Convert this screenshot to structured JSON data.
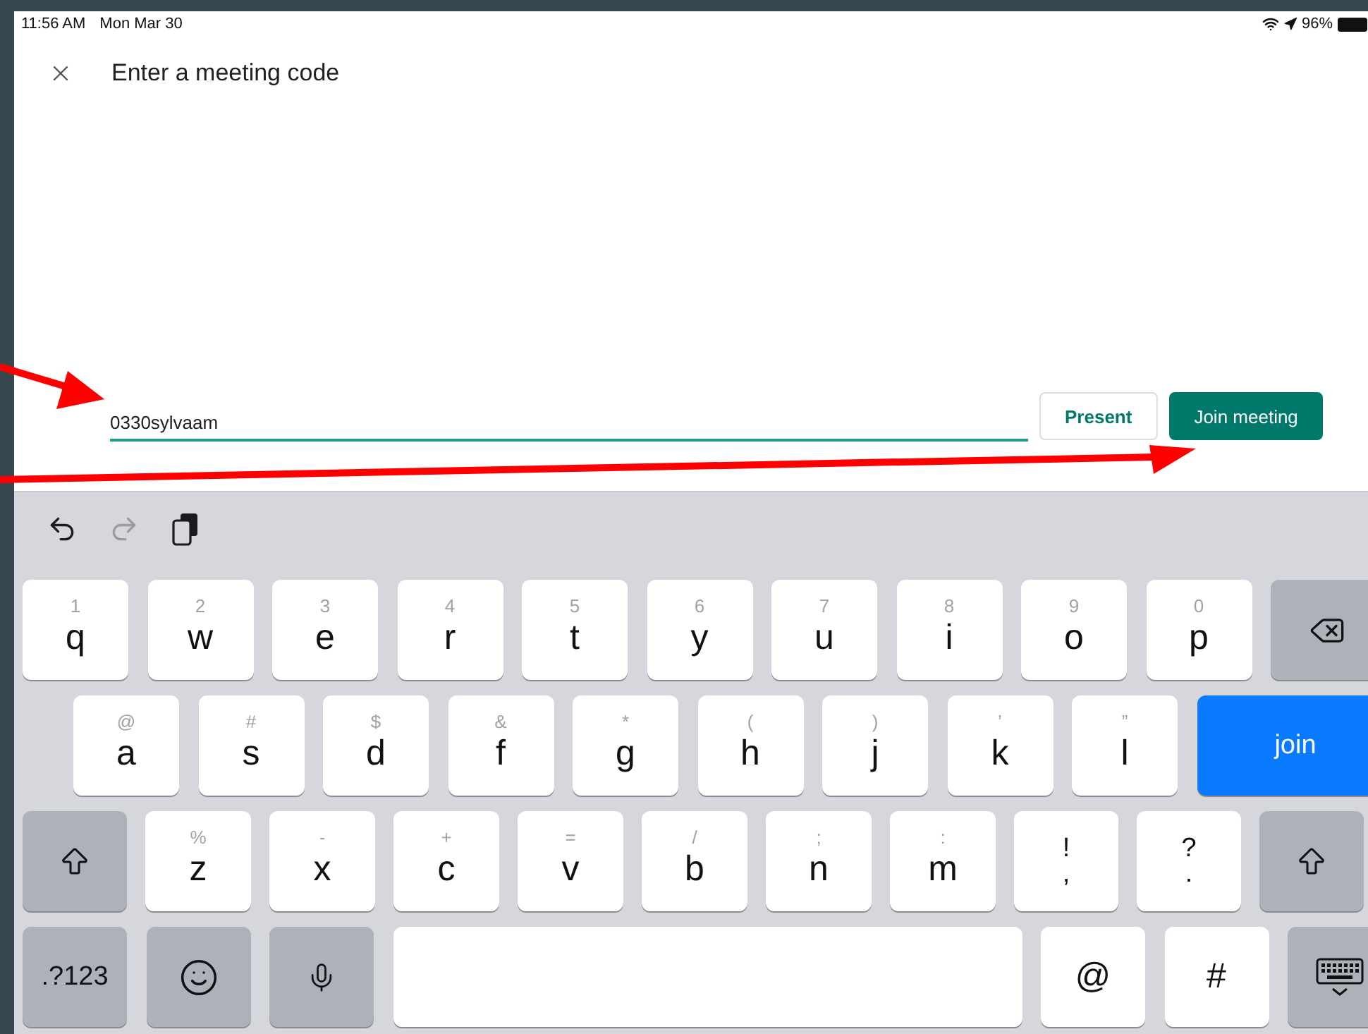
{
  "status_bar": {
    "time": "11:56 AM",
    "date": "Mon Mar 30",
    "battery": "96%"
  },
  "header": {
    "title": "Enter a meeting code"
  },
  "code_field": {
    "value": "0330sylvaam"
  },
  "buttons": [
    {
      "label": "Present",
      "kind": "outlined"
    },
    {
      "label": "Join meeting",
      "kind": "filled"
    }
  ],
  "keyboard": {
    "toolbar": [
      {
        "kind": "undo",
        "disabled": false
      },
      {
        "kind": "redo",
        "disabled": true
      },
      {
        "kind": "paste",
        "disabled": false
      }
    ],
    "rows": [
      [
        {
          "kind": "letter",
          "hint": "1",
          "label": "q"
        },
        {
          "kind": "letter",
          "hint": "2",
          "label": "w"
        },
        {
          "kind": "letter",
          "hint": "3",
          "label": "e"
        },
        {
          "kind": "letter",
          "hint": "4",
          "label": "r"
        },
        {
          "kind": "letter",
          "hint": "5",
          "label": "t"
        },
        {
          "kind": "letter",
          "hint": "6",
          "label": "y"
        },
        {
          "kind": "letter",
          "hint": "7",
          "label": "u"
        },
        {
          "kind": "letter",
          "hint": "8",
          "label": "i"
        },
        {
          "kind": "letter",
          "hint": "9",
          "label": "o"
        },
        {
          "kind": "letter",
          "hint": "0",
          "label": "p"
        },
        {
          "kind": "delete"
        }
      ],
      [
        {
          "kind": "letter",
          "hint": "@",
          "label": "a"
        },
        {
          "kind": "letter",
          "hint": "#",
          "label": "s"
        },
        {
          "kind": "letter",
          "hint": "$",
          "label": "d"
        },
        {
          "kind": "letter",
          "hint": "&",
          "label": "f"
        },
        {
          "kind": "letter",
          "hint": "*",
          "label": "g"
        },
        {
          "kind": "letter",
          "hint": "(",
          "label": "h"
        },
        {
          "kind": "letter",
          "hint": ")",
          "label": "j"
        },
        {
          "kind": "letter",
          "hint": "’",
          "label": "k"
        },
        {
          "kind": "letter",
          "hint": "”",
          "label": "l"
        },
        {
          "kind": "action",
          "label": "join"
        }
      ],
      [
        {
          "kind": "shift"
        },
        {
          "kind": "letter",
          "hint": "%",
          "label": "z"
        },
        {
          "kind": "letter",
          "hint": "-",
          "label": "x"
        },
        {
          "kind": "letter",
          "hint": "+",
          "label": "c"
        },
        {
          "kind": "letter",
          "hint": "=",
          "label": "v"
        },
        {
          "kind": "letter",
          "hint": "/",
          "label": "b"
        },
        {
          "kind": "letter",
          "hint": ";",
          "label": "n"
        },
        {
          "kind": "letter",
          "hint": ":",
          "label": "m"
        },
        {
          "kind": "dual",
          "top": "!",
          "bottom": ","
        },
        {
          "kind": "dual",
          "top": "?",
          "bottom": "."
        },
        {
          "kind": "shift"
        }
      ],
      [
        {
          "kind": "mode",
          "label": ".?123"
        },
        {
          "kind": "emoji"
        },
        {
          "kind": "mic"
        },
        {
          "kind": "space"
        },
        {
          "kind": "symbol",
          "label": "@"
        },
        {
          "kind": "symbol",
          "label": "#"
        },
        {
          "kind": "dismiss"
        }
      ]
    ]
  }
}
